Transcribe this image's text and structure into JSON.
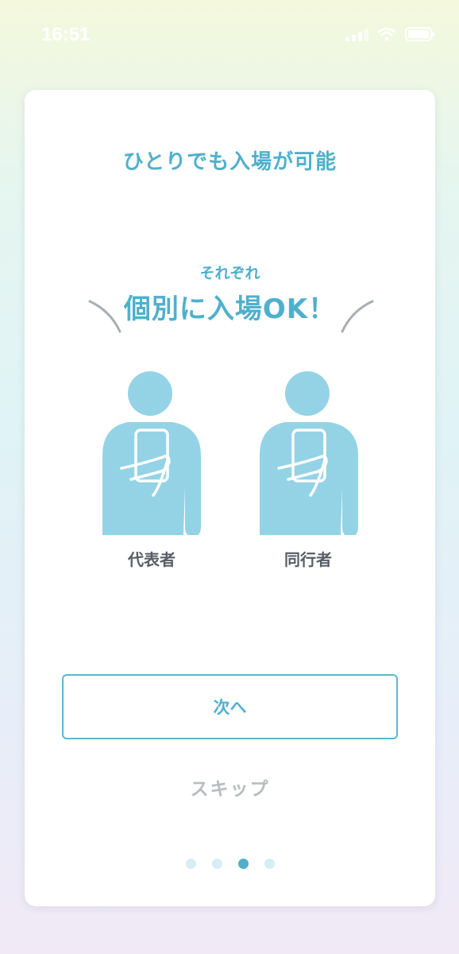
{
  "status_bar": {
    "time": "16:51",
    "signal_icon": "cellular-signal-icon",
    "wifi_icon": "wifi-icon",
    "battery_icon": "battery-icon"
  },
  "card": {
    "title": "ひとりでも入場が可能",
    "illustration": {
      "caption_small": "それぞれ",
      "headline": "個別に入場OK！",
      "people": [
        {
          "label": "代表者",
          "icon": "person-with-phone-icon"
        },
        {
          "label": "同行者",
          "icon": "person-with-phone-icon"
        }
      ]
    },
    "next_button_label": "次へ",
    "skip_label": "スキップ",
    "pagination": {
      "total": 4,
      "active_index": 3
    }
  },
  "colors": {
    "accent": "#4fb0cc",
    "figure": "#94d3e5",
    "label_text": "#555e66",
    "skip_text": "#b7bcc0",
    "dot_inactive": "#d6edf4"
  }
}
